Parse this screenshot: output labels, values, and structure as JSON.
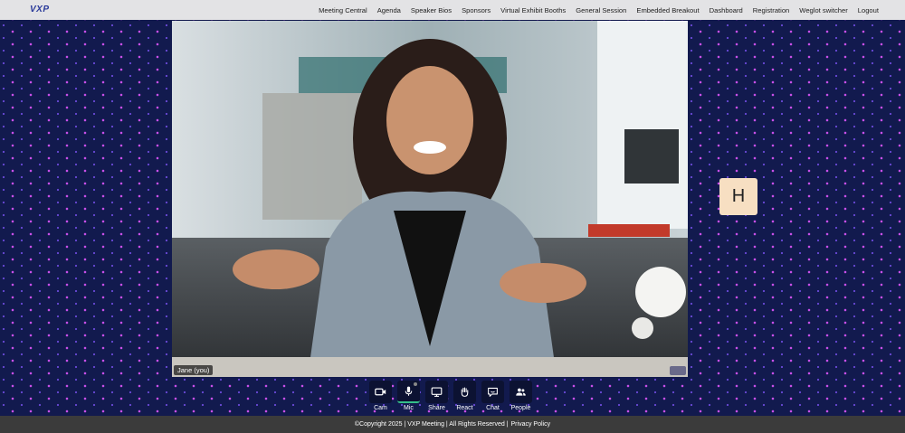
{
  "header": {
    "logo": "VXP",
    "nav": [
      "Meeting Central",
      "Agenda",
      "Speaker Bios",
      "Sponsors",
      "Virtual Exhibit Booths",
      "General Session",
      "Embedded Breakout",
      "Dashboard",
      "Registration",
      "Weglot switcher",
      "Logout"
    ]
  },
  "video": {
    "name_tag": "Jane (you)"
  },
  "participant": {
    "initial": "H"
  },
  "controls": [
    {
      "label": "Cam",
      "icon": "camera-icon"
    },
    {
      "label": "Mic",
      "icon": "microphone-icon"
    },
    {
      "label": "Share",
      "icon": "screen-share-icon"
    },
    {
      "label": "React",
      "icon": "hand-icon"
    },
    {
      "label": "Chat",
      "icon": "chat-icon"
    },
    {
      "label": "People",
      "icon": "people-icon"
    }
  ],
  "footer": {
    "copyright": "©Copyright 2025 | VXP Meeting | All Rights Reserved |",
    "privacy": "Privacy Policy"
  },
  "colors": {
    "background": "#121a4e",
    "dot_accent": "#c84fe8",
    "tile": "#f7dfc2",
    "active": "#35c08a"
  }
}
